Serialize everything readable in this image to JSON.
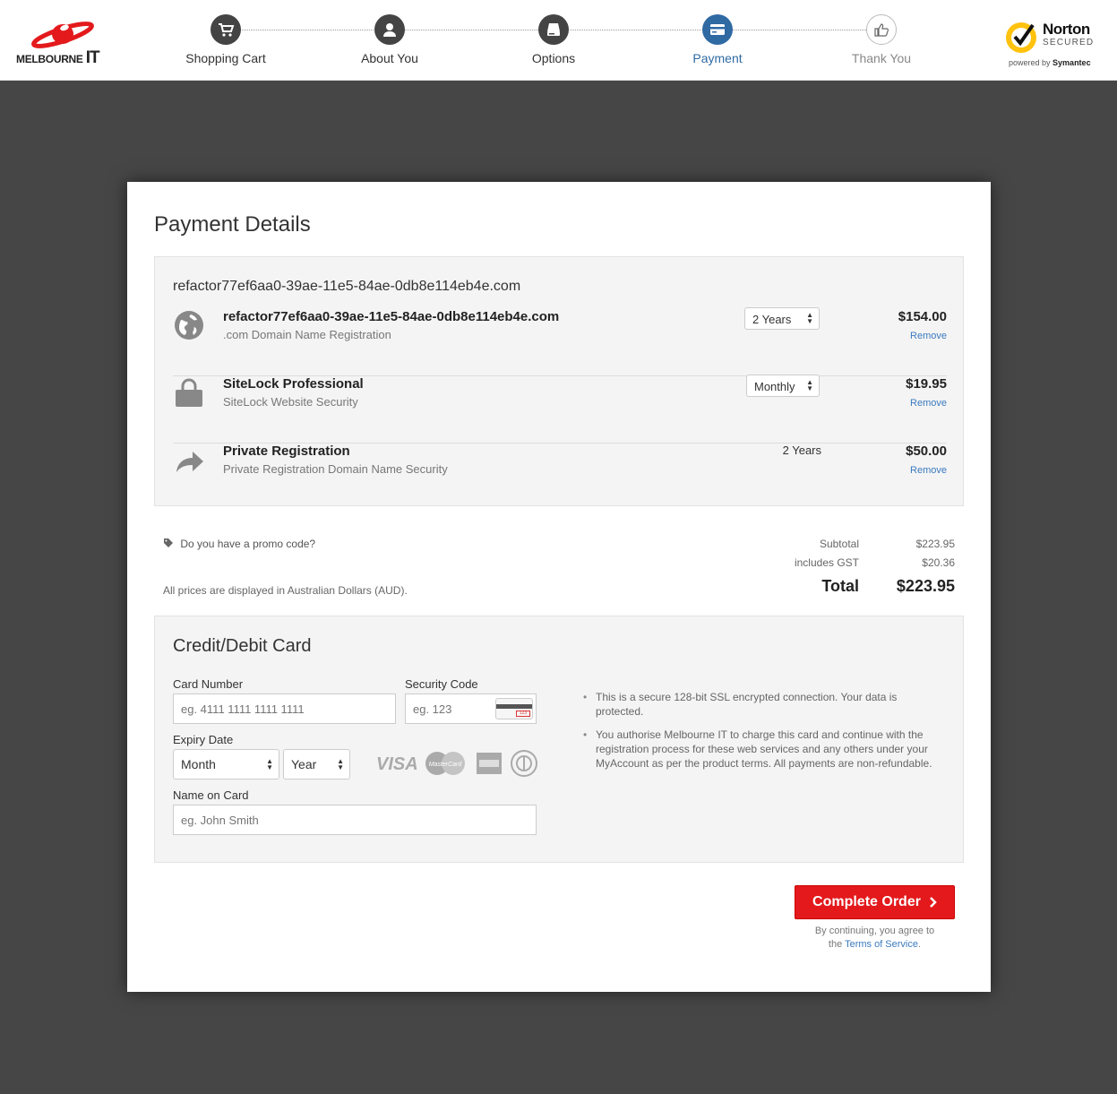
{
  "brand": {
    "logo_text": "MELBOURNE",
    "logo_it": "IT",
    "logo_color": "#e3191c"
  },
  "steps": [
    {
      "label": "Shopping Cart",
      "icon": "cart-icon",
      "state": "done"
    },
    {
      "label": "About You",
      "icon": "user-icon",
      "state": "done"
    },
    {
      "label": "Options",
      "icon": "drive-icon",
      "state": "done"
    },
    {
      "label": "Payment",
      "icon": "card-icon",
      "state": "active"
    },
    {
      "label": "Thank You",
      "icon": "thumbs-up-icon",
      "state": "future"
    }
  ],
  "norton": {
    "name": "Norton",
    "secured": "SECURED",
    "powered_by": "powered by",
    "symantec": "Symantec"
  },
  "page": {
    "title": "Payment Details"
  },
  "cart": {
    "domain": "refactor77ef6aa0-39ae-11e5-84ae-0db8e114eb4e.com",
    "items": [
      {
        "name": "refactor77ef6aa0-39ae-11e5-84ae-0db8e114eb4e.com",
        "desc": ".com Domain Name Registration",
        "term": "2 Years",
        "term_type": "select",
        "price": "$154.00",
        "remove": "Remove",
        "icon": "globe-icon"
      },
      {
        "name": "SiteLock Professional",
        "desc": "SiteLock Website Security",
        "term": "Monthly",
        "term_type": "select",
        "price": "$19.95",
        "remove": "Remove",
        "icon": "lock-icon"
      },
      {
        "name": "Private Registration",
        "desc": "Private Registration Domain Name Security",
        "term": "2 Years",
        "term_type": "text",
        "price": "$50.00",
        "remove": "Remove",
        "icon": "share-arrow-icon"
      }
    ]
  },
  "promo": {
    "text": "Do you have a promo code?",
    "icon": "tag-icon"
  },
  "currency_note": "All prices are displayed in Australian Dollars (AUD).",
  "totals": {
    "subtotal_label": "Subtotal",
    "subtotal": "$223.95",
    "gst_label": "includes GST",
    "gst": "$20.36",
    "total_label": "Total",
    "total": "$223.95"
  },
  "card_form": {
    "title": "Credit/Debit Card",
    "card_number_label": "Card Number",
    "card_number_placeholder": "eg. 4111 1111 1111 1111",
    "security_code_label": "Security Code",
    "security_code_placeholder": "eg. 123",
    "cvv_digits": "123",
    "expiry_label": "Expiry Date",
    "month": "Month",
    "year": "Year",
    "name_label": "Name on Card",
    "name_placeholder": "eg. John Smith",
    "card_brands": [
      "VISA",
      "MasterCard",
      "American Express",
      "Diners Club"
    ],
    "notes": [
      "This is a secure 128-bit SSL encrypted connection. Your data is protected.",
      "You authorise Melbourne IT to charge this card and continue with the registration process for these web services and any others under your MyAccount as per the product terms. All payments are non-refundable."
    ]
  },
  "submit": {
    "label": "Complete Order",
    "agree_prefix": "By continuing, you agree to",
    "agree_the": "the",
    "tos": "Terms of Service",
    "agree_suffix": "."
  },
  "colors": {
    "active_step": "#2f6aa3",
    "button": "#e3191c",
    "link": "#3a7abf",
    "page_bg": "#464646"
  }
}
